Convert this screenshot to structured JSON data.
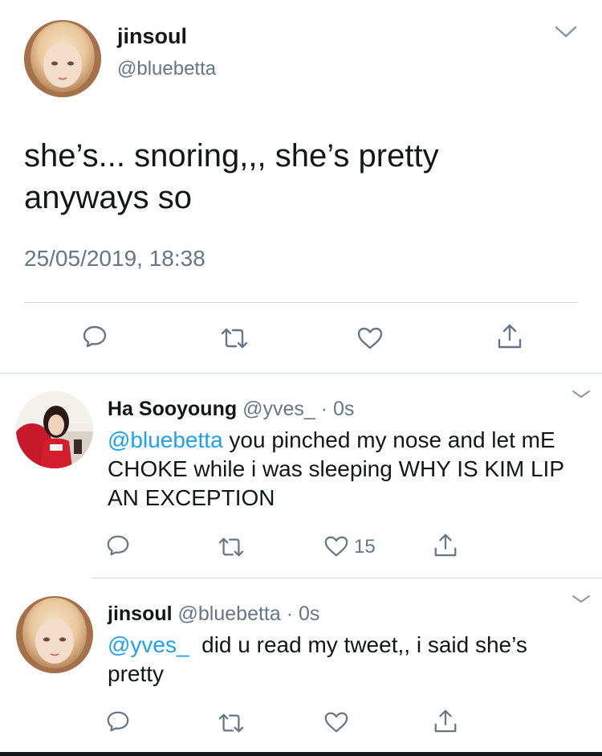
{
  "main_tweet": {
    "display_name": "jinsoul",
    "handle": "@bluebetta",
    "text": "she’s... snoring,,, she’s pretty anyways so",
    "timestamp": "25/05/2019, 18:38"
  },
  "replies": [
    {
      "display_name": "Ha Sooyoung",
      "handle": "@yves_",
      "separator": "·",
      "time": "0s",
      "mention": "@bluebetta",
      "text": " you pinched my nose and let mE CHOKE while i was sleeping WHY IS KIM LIP AN EXCEPTION",
      "like_count": "15"
    },
    {
      "display_name": "jinsoul",
      "handle": "@bluebetta",
      "separator": "·",
      "time": "0s",
      "mention": "@yves_",
      "text": "  did u read my tweet,, i said she’s pretty",
      "like_count": ""
    }
  ],
  "icons": [
    "reply-icon",
    "retweet-icon",
    "like-icon",
    "share-icon",
    "chevron-down-icon"
  ],
  "colors": {
    "accent": "#1da1f2",
    "text": "#14171a",
    "secondary": "#657786",
    "divider": "#ccd6dd"
  }
}
